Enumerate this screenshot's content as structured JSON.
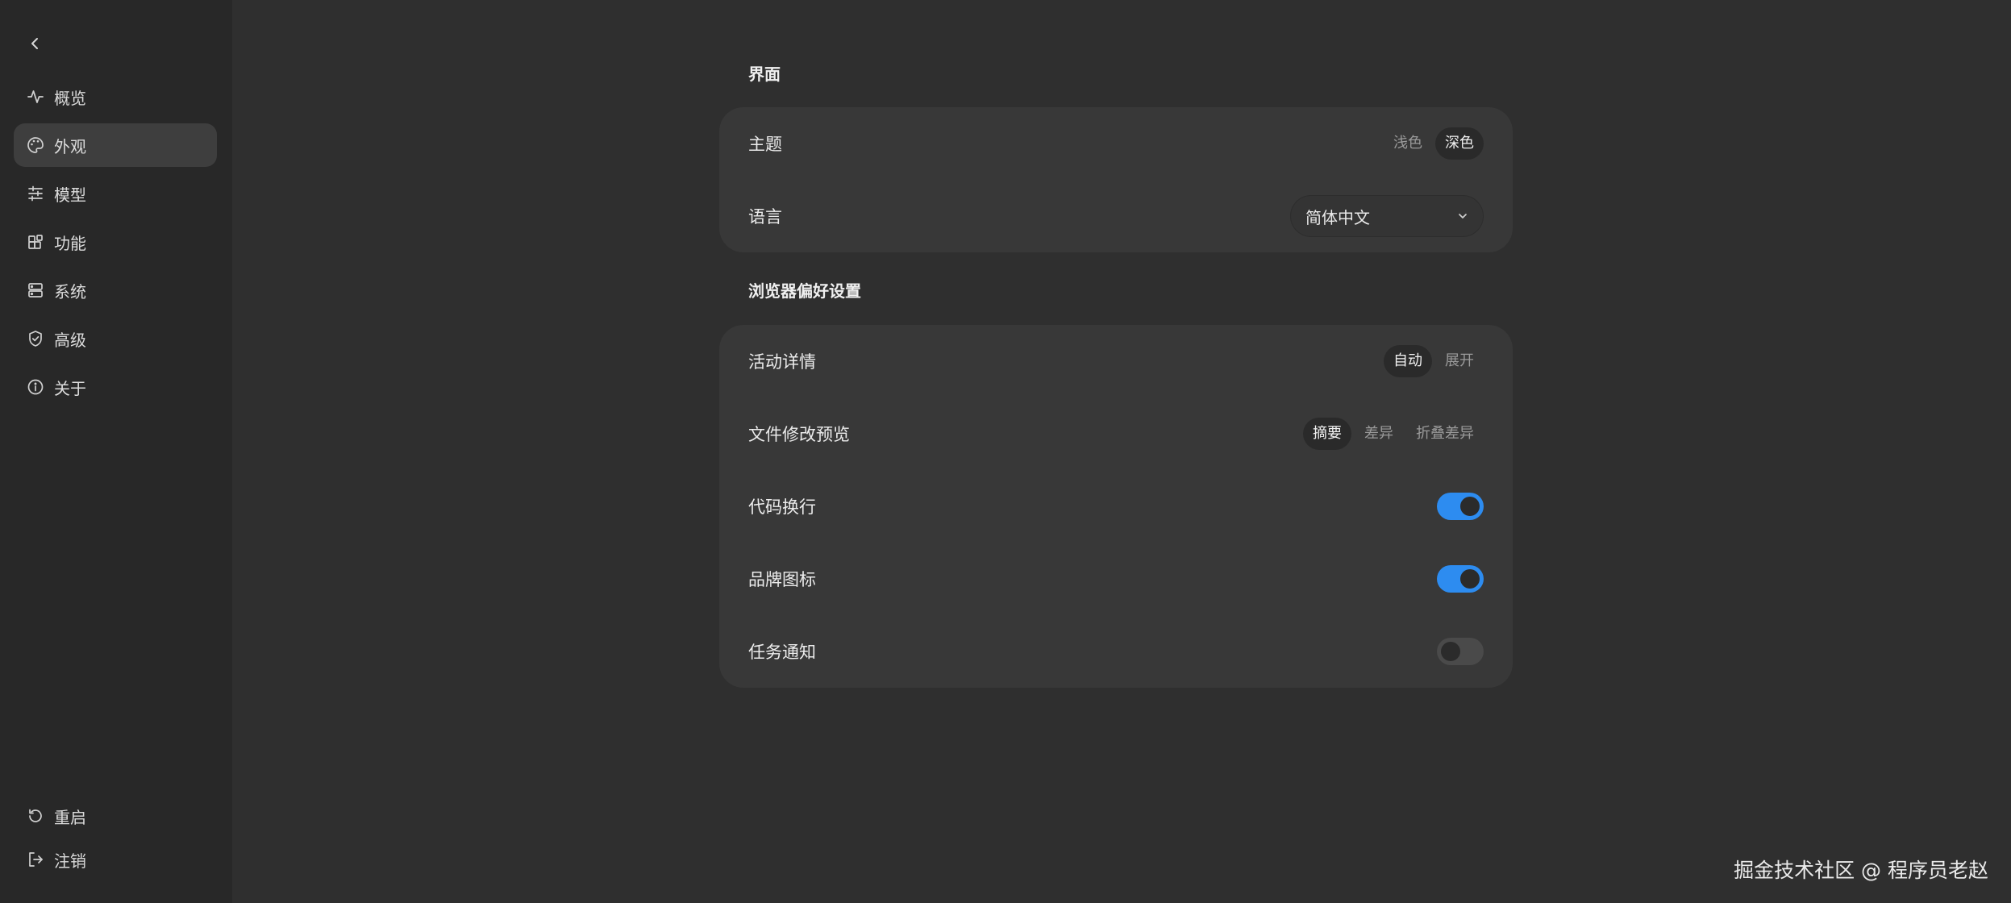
{
  "sidebar": {
    "back_icon": "chevron-left-icon",
    "items": [
      {
        "label": "概览",
        "icon": "activity-icon"
      },
      {
        "label": "外观",
        "icon": "palette-icon",
        "active": true
      },
      {
        "label": "模型",
        "icon": "sliders-icon"
      },
      {
        "label": "功能",
        "icon": "blocks-icon"
      },
      {
        "label": "系统",
        "icon": "server-icon"
      },
      {
        "label": "高级",
        "icon": "shield-icon"
      },
      {
        "label": "关于",
        "icon": "info-icon"
      }
    ],
    "bottom_items": [
      {
        "label": "重启",
        "icon": "restart-icon"
      },
      {
        "label": "注销",
        "icon": "logout-icon"
      }
    ]
  },
  "interface": {
    "title": "界面",
    "theme": {
      "label": "主题",
      "options": [
        "浅色",
        "深色"
      ],
      "selected": "深色"
    },
    "language": {
      "label": "语言",
      "value": "简体中文"
    }
  },
  "browser": {
    "title": "浏览器偏好设置",
    "activity": {
      "label": "活动详情",
      "options": [
        "自动",
        "展开"
      ],
      "selected": "自动"
    },
    "file_preview": {
      "label": "文件修改预览",
      "options": [
        "摘要",
        "差异",
        "折叠差异"
      ],
      "selected": "摘要"
    },
    "code_wrap": {
      "label": "代码换行",
      "on": true
    },
    "brand_icon": {
      "label": "品牌图标",
      "on": true
    },
    "task_notify": {
      "label": "任务通知",
      "on": false
    }
  },
  "colors": {
    "accent": "#2d8cf0",
    "background": "#2f2f2f",
    "sidebar": "#282828",
    "card": "#383838"
  },
  "watermark": "掘金技术社区 @ 程序员老赵"
}
